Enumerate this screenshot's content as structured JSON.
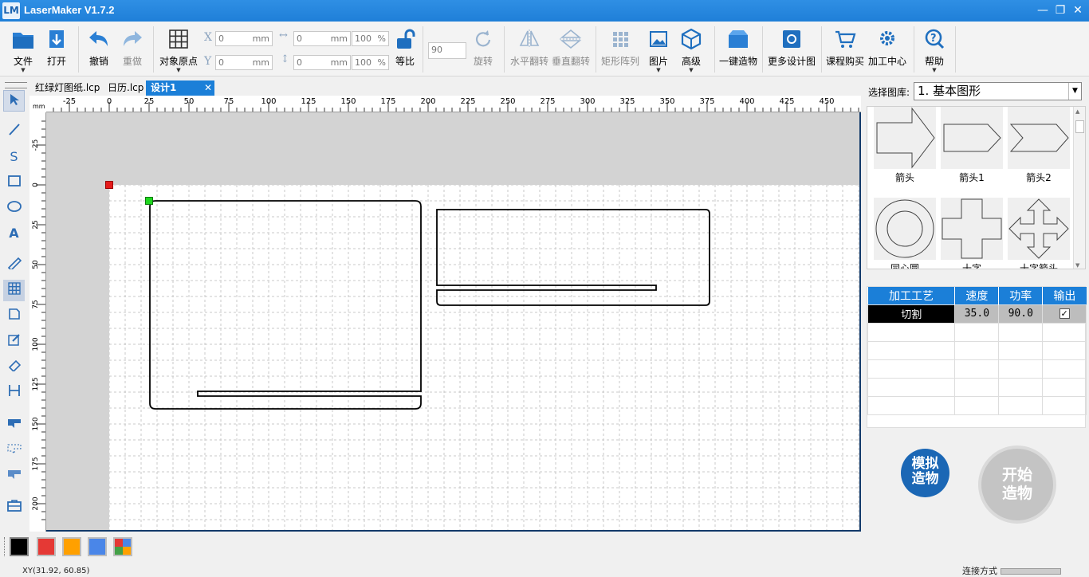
{
  "window": {
    "title": "LaserMaker V1.7.2",
    "logo_text": "LM"
  },
  "toolbar": {
    "file": "文件",
    "open": "打开",
    "undo": "撤销",
    "redo": "重做",
    "origin": "对象原点",
    "x_label": "X",
    "y_label": "Y",
    "x_value": "0",
    "y_value": "0",
    "w_value": "0",
    "h_value": "0",
    "unit": "mm",
    "w_pct": "100",
    "h_pct": "100",
    "pct_unit": "%",
    "proportional": "等比",
    "rotate_value": "90",
    "rotate": "旋转",
    "hflip": "水平翻转",
    "vflip": "垂直翻转",
    "array": "矩形阵列",
    "image": "图片",
    "advanced": "高级",
    "oneclick": "一键造物",
    "more": "更多设计图",
    "course": "课程购买",
    "center": "加工中心",
    "help": "帮助"
  },
  "tabs": [
    {
      "label": "红绿灯图纸.lcp",
      "active": false
    },
    {
      "label": "日历.lcp",
      "active": false
    },
    {
      "label": "设计1",
      "active": true
    }
  ],
  "tab_close": "✕",
  "ruler": {
    "unit": "mm",
    "top_ticks": [
      "-25",
      "0",
      "25",
      "50",
      "75",
      "100",
      "125",
      "150",
      "175",
      "200",
      "225",
      "250",
      "275",
      "300",
      "325",
      "350",
      "375",
      "400",
      "425",
      "450"
    ],
    "left_ticks": [
      "-25",
      "0",
      "25",
      "50",
      "75",
      "100",
      "125",
      "150",
      "175",
      "200"
    ]
  },
  "library": {
    "label": "选择图库:",
    "selected": "1. 基本图形",
    "shapes": [
      "箭头",
      "箭头1",
      "箭头2",
      "同心圆",
      "十字",
      "十字箭头"
    ]
  },
  "process_table": {
    "headers": [
      "加工工艺",
      "速度",
      "功率",
      "输出"
    ],
    "rows": [
      {
        "mode": "切割",
        "speed": "35.0",
        "power": "90.0",
        "output": "✓"
      }
    ]
  },
  "buttons": {
    "simulate": "模拟造物",
    "sim_l1": "模拟",
    "sim_l2": "造物",
    "start_l1": "开始",
    "start_l2": "造物"
  },
  "colors": {
    "accent": "#1b7fd8",
    "palette": [
      "#000000",
      "#e53935",
      "#ffa000",
      "#4a86e8",
      "multi"
    ]
  },
  "status": {
    "coords": "XY(31.92, 60.85)",
    "connection": "连接方式"
  }
}
